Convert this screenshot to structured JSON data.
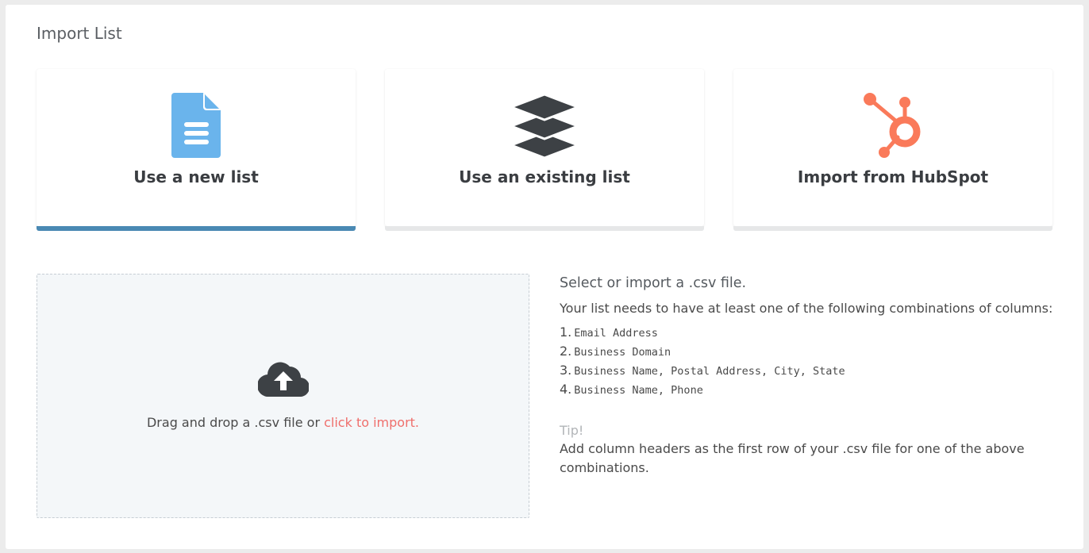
{
  "page": {
    "title": "Import List"
  },
  "cards": [
    {
      "label": "Use a new list",
      "icon": "document-icon",
      "selected": true
    },
    {
      "label": "Use an existing list",
      "icon": "layers-icon",
      "selected": false
    },
    {
      "label": "Import from HubSpot",
      "icon": "hubspot-icon",
      "selected": false
    }
  ],
  "dropzone": {
    "icon": "cloud-upload-icon",
    "text": "Drag and drop a .csv file or ",
    "link": "click to import."
  },
  "info": {
    "heading": "Select or import a .csv file.",
    "subheading": "Your list needs to have at least one of the following combinations of columns:",
    "requirements": [
      {
        "num": "1.",
        "text": "Email Address"
      },
      {
        "num": "2.",
        "text": "Business Domain"
      },
      {
        "num": "3.",
        "text": "Business Name, Postal Address, City, State"
      },
      {
        "num": "4.",
        "text": "Business Name, Phone"
      }
    ],
    "tip_label": "Tip!",
    "tip_text": "Add column headers as the first row of your .csv file for one of the above combinations."
  },
  "colors": {
    "accent": "#4a89b3",
    "document_icon": "#6ab4ec",
    "layers_icon": "#3d4145",
    "hubspot_icon": "#fa7a5a",
    "link": "#ef6f6c",
    "tip": "#b2b5b8"
  }
}
